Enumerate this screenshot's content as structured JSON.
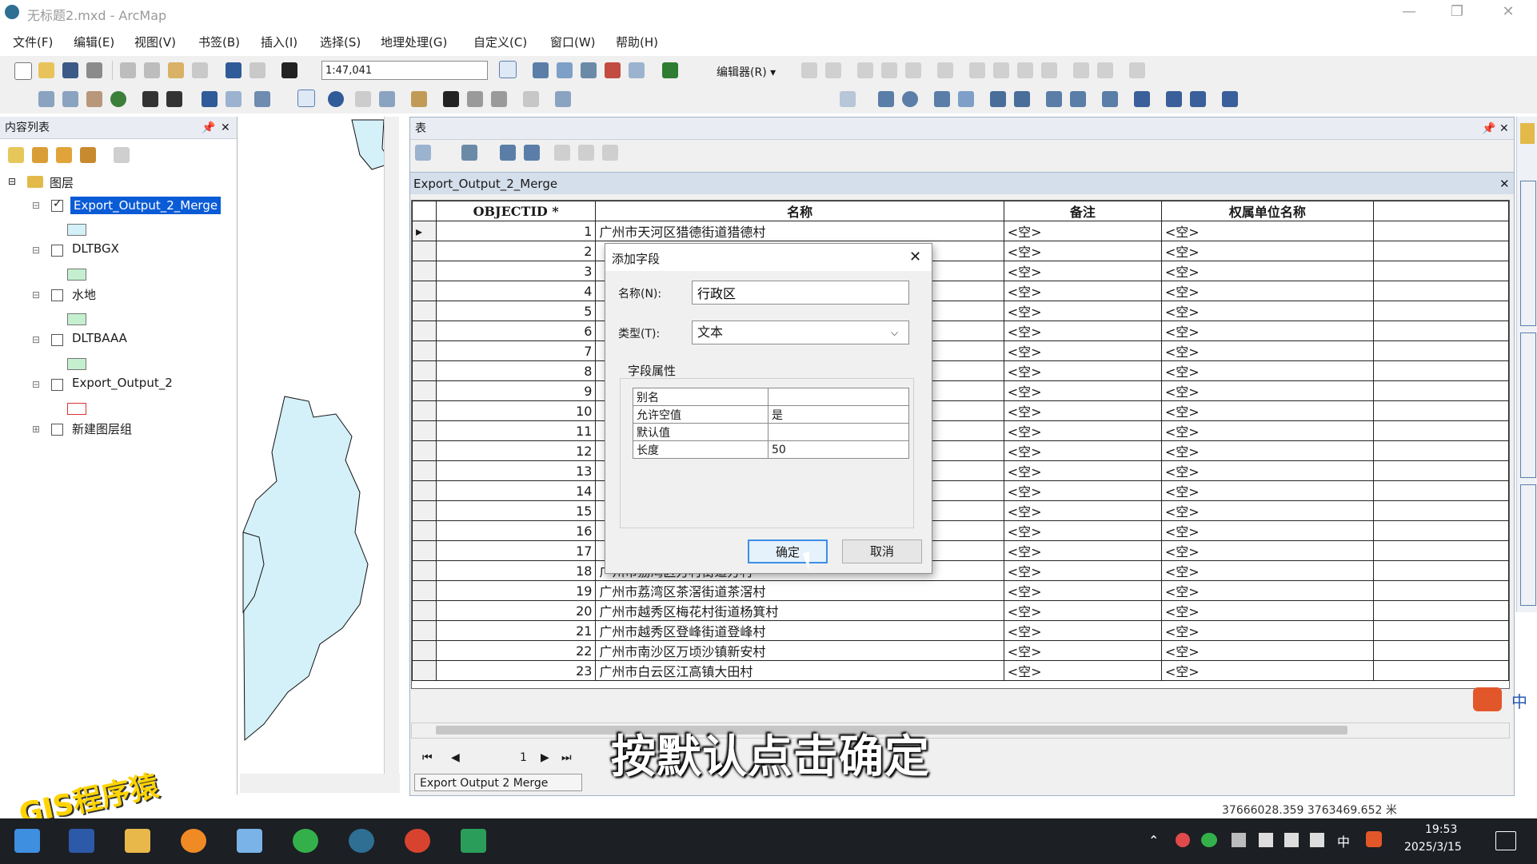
{
  "window": {
    "title": "无标题2.mxd - ArcMap",
    "minimize": "—",
    "restore": "❐",
    "close": "✕"
  },
  "menu": [
    "文件(F)",
    "编辑(E)",
    "视图(V)",
    "书签(B)",
    "插入(I)",
    "选择(S)",
    "地理处理(G)",
    "自定义(C)",
    "窗口(W)",
    "帮助(H)"
  ],
  "toolbar": {
    "scale": "1:47,041",
    "editor_label": "编辑器(R) ▾"
  },
  "toc": {
    "title": "内容列表",
    "root": "图层",
    "layers": [
      {
        "name": "Export_Output_2_Merge",
        "checked": true,
        "selected": true,
        "color": "#d4f0f8"
      },
      {
        "name": "DLTBGX",
        "checked": false,
        "color": "#c4f0d0"
      },
      {
        "name": "水地",
        "checked": false,
        "color": "#c4f0d0"
      },
      {
        "name": "DLTBAAA",
        "checked": false,
        "color": "#c4f0d0"
      },
      {
        "name": "Export_Output_2",
        "checked": false,
        "color": "#ffffff"
      },
      {
        "name": "新建图层组",
        "checked": false
      }
    ]
  },
  "table_window": {
    "title": "表",
    "table_name": "Export_Output_2_Merge",
    "columns": [
      "OBJECTID *",
      "名称",
      "备注",
      "权属单位名称"
    ],
    "null_text": "<空>",
    "rows": [
      {
        "id": "1",
        "name": "广州市天河区猎德街道猎德村"
      },
      {
        "id": "2",
        "name": ""
      },
      {
        "id": "3",
        "name": ""
      },
      {
        "id": "4",
        "name": ""
      },
      {
        "id": "5",
        "name": ""
      },
      {
        "id": "6",
        "name": ""
      },
      {
        "id": "7",
        "name": ""
      },
      {
        "id": "8",
        "name": ""
      },
      {
        "id": "9",
        "name": ""
      },
      {
        "id": "10",
        "name": ""
      },
      {
        "id": "11",
        "name": ""
      },
      {
        "id": "12",
        "name": ""
      },
      {
        "id": "13",
        "name": ""
      },
      {
        "id": "14",
        "name": ""
      },
      {
        "id": "15",
        "name": ""
      },
      {
        "id": "16",
        "name": ""
      },
      {
        "id": "17",
        "name": ""
      },
      {
        "id": "18",
        "name": "广州市荔湾区方村街道方村"
      },
      {
        "id": "19",
        "name": "广州市荔湾区茶滘街道茶滘村"
      },
      {
        "id": "20",
        "name": "广州市越秀区梅花村街道杨箕村"
      },
      {
        "id": "21",
        "name": "广州市越秀区登峰街道登峰村"
      },
      {
        "id": "22",
        "name": "广州市南沙区万顷沙镇新安村"
      },
      {
        "id": "23",
        "name": "广州市白云区江高镇大田村"
      }
    ],
    "record_position": "1",
    "bottom_tab": "Export Output 2 Merge"
  },
  "dialog": {
    "title": "添加字段",
    "name_label": "名称(N):",
    "name_value": "行政区",
    "type_label": "类型(T):",
    "type_value": "文本",
    "group_label": "字段属性",
    "props": [
      {
        "key": "别名",
        "value": ""
      },
      {
        "key": "允许空值",
        "value": "是"
      },
      {
        "key": "默认值",
        "value": ""
      },
      {
        "key": "长度",
        "value": "50"
      }
    ],
    "ok": "确定",
    "cancel": "取消"
  },
  "subtitle": "按默认点击确定",
  "watermark": "GIS程序猿",
  "status": {
    "coords": "37666028.359  3763469.652 米"
  },
  "taskbar": {
    "time": "19:53",
    "date": "2025/3/15",
    "ime": "中"
  }
}
